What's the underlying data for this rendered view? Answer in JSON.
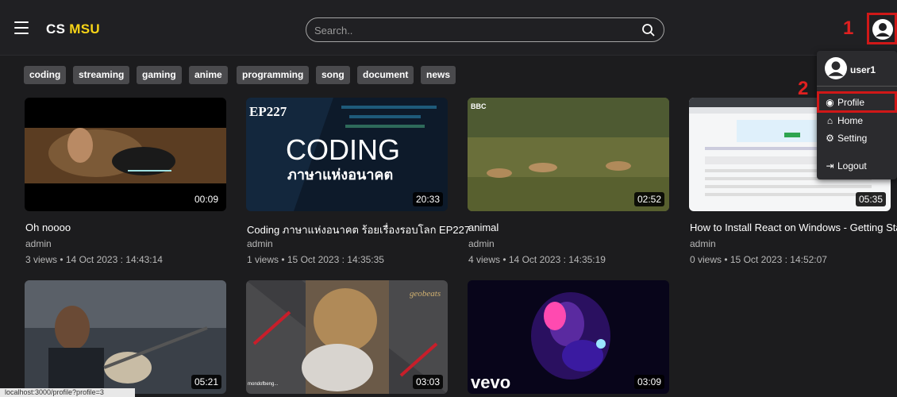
{
  "header": {
    "brand_prefix": "CS",
    "brand_highlight": "MSU",
    "search_placeholder": "Search..",
    "annotation_1": "1",
    "annotation_2": "2"
  },
  "categories": [
    "coding",
    "streaming",
    "gaming",
    "anime",
    "programming",
    "song",
    "document",
    "news"
  ],
  "videos": [
    {
      "title": "Oh noooo",
      "author": "admin",
      "meta": "3 views • 14 Oct 2023 : 14:43:14",
      "duration": "00:09"
    },
    {
      "title": "Coding ภาษาแห่งอนาคต ร้อยเรื่องรอบโลก EP227",
      "author": "admin",
      "meta": "1 views • 15 Oct 2023 : 14:35:35",
      "duration": "20:33",
      "thumb_text": [
        "EP227",
        "CODING",
        "ภาษาแห่งอนาคต"
      ]
    },
    {
      "title": "animal",
      "author": "admin",
      "meta": "4 views • 14 Oct 2023 : 14:35:19",
      "duration": "02:52",
      "thumb_text": [
        "BBC"
      ]
    },
    {
      "title": "How to Install React on Windows - Getting Started",
      "author": "admin",
      "meta": "0 views • 15 Oct 2023 : 14:52:07",
      "duration": "05:35"
    },
    {
      "title": "",
      "author": "",
      "meta": "",
      "duration": "05:21"
    },
    {
      "title": "",
      "author": "",
      "meta": "",
      "duration": "03:03",
      "thumb_text": [
        "geobeats",
        "mondofbeng..."
      ]
    },
    {
      "title": "",
      "author": "",
      "meta": "",
      "duration": "03:09",
      "thumb_text": [
        "vevo"
      ]
    }
  ],
  "user_menu": {
    "username": "user1",
    "items": [
      {
        "label": "Profile",
        "icon": "user-circle-icon"
      },
      {
        "label": "Home",
        "icon": "home-icon"
      },
      {
        "label": "Setting",
        "icon": "users-cog-icon"
      },
      {
        "label": "Logout",
        "icon": "logout-icon"
      }
    ]
  },
  "status_url": "localhost:3000/profile?profile=3",
  "colors": {
    "brand_highlight": "#f7d417",
    "annotation": "#d01818",
    "chip_bg": "#4a4a4d",
    "page_bg": "#1c1c1e"
  }
}
